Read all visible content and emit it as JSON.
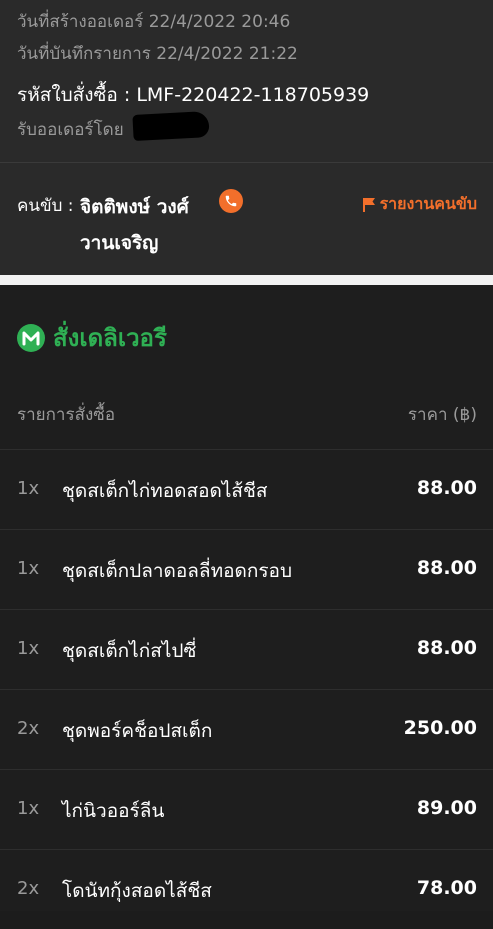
{
  "order_info": {
    "created_label": "วันที่สร้างออเดอร์ 22/4/2022 20:46",
    "recorded_label": "วันที่บันทึกรายการ 22/4/2022 21:22",
    "order_id_label": "รหัสใบสั่งซื้อ : LMF-220422-118705939",
    "received_by_label": "รับออเดอร์โดย"
  },
  "driver": {
    "label": "คนขับ :",
    "name": "จิตติพงษ์ วงศ์วานเจริญ",
    "report_label": "รายงานคนขับ",
    "colors": {
      "accent": "#f26f2b"
    },
    "icons": [
      "phone-icon",
      "flag-icon"
    ]
  },
  "delivery": {
    "title": "สั่งเดลิเวอรี",
    "icon": "m-logo-icon",
    "color": "#2fb054",
    "header_item": "รายการสั่งซื้อ",
    "header_price": "ราคา (฿)",
    "items": [
      {
        "qty": "1x",
        "name": "ชุดสเต็กไก่ทอดสอดไส้ชีส",
        "price": "88.00"
      },
      {
        "qty": "1x",
        "name": "ชุดสเต็กปลาดอลลี่ทอดกรอบ",
        "price": "88.00"
      },
      {
        "qty": "1x",
        "name": "ชุดสเต็กไก่สไปซี่",
        "price": "88.00"
      },
      {
        "qty": "2x",
        "name": "ชุดพอร์คช็อปสเต็ก",
        "price": "250.00"
      },
      {
        "qty": "1x",
        "name": "ไก่นิวออร์ลีน",
        "price": "89.00"
      },
      {
        "qty": "2x",
        "name": "โดนัทกุ้งสอดไส้ชีส",
        "price": "78.00"
      }
    ]
  }
}
